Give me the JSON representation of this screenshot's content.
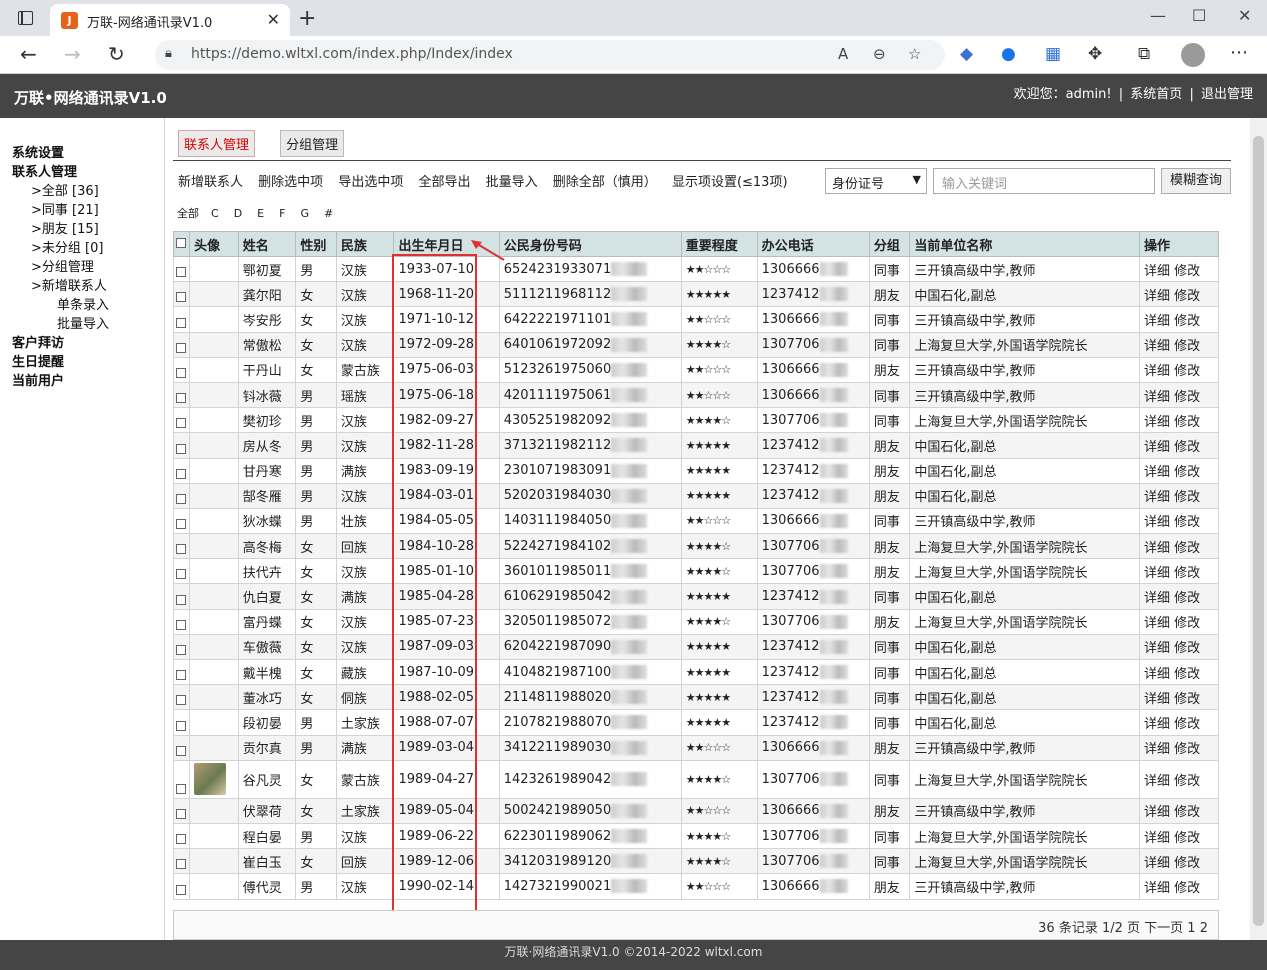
{
  "browser": {
    "tab_title": "万联-网络通讯录V1.0",
    "url": "https://demo.wltxl.com/index.php/Index/index"
  },
  "header": {
    "brand": "万联•网络通讯录V1.0",
    "welcome": "欢迎您：admin!",
    "sep": "|",
    "home": "系统首页",
    "logout": "退出管理"
  },
  "sidebar": {
    "system": "系统设置",
    "contacts": "联系人管理",
    "all": ">全部 [36]",
    "colleague": ">同事 [21]",
    "friend": ">朋友 [15]",
    "ungrouped": ">未分组 [0]",
    "groups": ">分组管理",
    "add": ">新增联系人",
    "single": "单条录入",
    "batch": "批量导入",
    "visits": "客户拜访",
    "birthday": "生日提醒",
    "user": "当前用户"
  },
  "tabs": {
    "contacts": "联系人管理",
    "groups": "分组管理"
  },
  "toolbar": {
    "add": "新增联系人",
    "delsel": "删除选中项",
    "expsel": "导出选中项",
    "expall": "全部导出",
    "import": "批量导入",
    "delall": "删除全部（慎用）",
    "cols": "显示项设置(≤13项)"
  },
  "search": {
    "field": "身份证号",
    "placeholder": "输入关键词",
    "button": "模糊查询"
  },
  "letters": [
    "全部",
    "C",
    "D",
    "E",
    "F",
    "G",
    "#"
  ],
  "columns": [
    "头像",
    "姓名",
    "性别",
    "民族",
    "出生年月日",
    "公民身份号码",
    "重要程度",
    "办公电话",
    "分组",
    "当前单位名称",
    "操作"
  ],
  "rows": [
    [
      "鄂初夏",
      "男",
      "汉族",
      "1933-07-10",
      "6524231933071",
      "★★☆☆☆",
      "1306666",
      "同事",
      "三开镇高级中学,教师"
    ],
    [
      "龚尔阳",
      "女",
      "汉族",
      "1968-11-20",
      "5111211968112",
      "★★★★★",
      "1237412",
      "朋友",
      "中国石化,副总"
    ],
    [
      "岑安彤",
      "女",
      "汉族",
      "1971-10-12",
      "6422221971101",
      "★★☆☆☆",
      "1306666",
      "同事",
      "三开镇高级中学,教师"
    ],
    [
      "常傲松",
      "女",
      "汉族",
      "1972-09-28",
      "6401061972092",
      "★★★★☆",
      "1307706",
      "同事",
      "上海复旦大学,外国语学院院长"
    ],
    [
      "干丹山",
      "女",
      "蒙古族",
      "1975-06-03",
      "5123261975060",
      "★★☆☆☆",
      "1306666",
      "朋友",
      "三开镇高级中学,教师"
    ],
    [
      "钭冰薇",
      "男",
      "瑶族",
      "1975-06-18",
      "4201111975061",
      "★★☆☆☆",
      "1306666",
      "同事",
      "三开镇高级中学,教师"
    ],
    [
      "樊初珍",
      "男",
      "汉族",
      "1982-09-27",
      "4305251982092",
      "★★★★☆",
      "1307706",
      "同事",
      "上海复旦大学,外国语学院院长"
    ],
    [
      "房从冬",
      "男",
      "汉族",
      "1982-11-28",
      "3713211982112",
      "★★★★★",
      "1237412",
      "朋友",
      "中国石化,副总"
    ],
    [
      "甘丹寒",
      "男",
      "满族",
      "1983-09-19",
      "2301071983091",
      "★★★★★",
      "1237412",
      "朋友",
      "中国石化,副总"
    ],
    [
      "郜冬雁",
      "男",
      "汉族",
      "1984-03-01",
      "5202031984030",
      "★★★★★",
      "1237412",
      "朋友",
      "中国石化,副总"
    ],
    [
      "狄冰蝶",
      "男",
      "壮族",
      "1984-05-05",
      "1403111984050",
      "★★☆☆☆",
      "1306666",
      "同事",
      "三开镇高级中学,教师"
    ],
    [
      "高冬梅",
      "女",
      "回族",
      "1984-10-28",
      "5224271984102",
      "★★★★☆",
      "1307706",
      "朋友",
      "上海复旦大学,外国语学院院长"
    ],
    [
      "扶代卉",
      "女",
      "汉族",
      "1985-01-10",
      "3601011985011",
      "★★★★☆",
      "1307706",
      "朋友",
      "上海复旦大学,外国语学院院长"
    ],
    [
      "仇白夏",
      "女",
      "满族",
      "1985-04-28",
      "6106291985042",
      "★★★★★",
      "1237412",
      "同事",
      "中国石化,副总"
    ],
    [
      "富丹蝶",
      "女",
      "汉族",
      "1985-07-23",
      "3205011985072",
      "★★★★☆",
      "1307706",
      "朋友",
      "上海复旦大学,外国语学院院长"
    ],
    [
      "车傲薇",
      "女",
      "汉族",
      "1987-09-03",
      "6204221987090",
      "★★★★★",
      "1237412",
      "同事",
      "中国石化,副总"
    ],
    [
      "戴半槐",
      "女",
      "藏族",
      "1987-10-09",
      "4104821987100",
      "★★★★★",
      "1237412",
      "同事",
      "中国石化,副总"
    ],
    [
      "董冰巧",
      "女",
      "侗族",
      "1988-02-05",
      "2114811988020",
      "★★★★★",
      "1237412",
      "同事",
      "中国石化,副总"
    ],
    [
      "段初晏",
      "男",
      "土家族",
      "1988-07-07",
      "2107821988070",
      "★★★★★",
      "1237412",
      "同事",
      "中国石化,副总"
    ],
    [
      "贡尔真",
      "男",
      "满族",
      "1989-03-04",
      "3412211989030",
      "★★☆☆☆",
      "1306666",
      "朋友",
      "三开镇高级中学,教师"
    ],
    [
      "谷凡灵",
      "女",
      "蒙古族",
      "1989-04-27",
      "1423261989042",
      "★★★★☆",
      "1307706",
      "同事",
      "上海复旦大学,外国语学院院长"
    ],
    [
      "伏翠荷",
      "女",
      "土家族",
      "1989-05-04",
      "5002421989050",
      "★★☆☆☆",
      "1306666",
      "朋友",
      "三开镇高级中学,教师"
    ],
    [
      "程白晏",
      "男",
      "汉族",
      "1989-06-22",
      "6223011989062",
      "★★★★☆",
      "1307706",
      "同事",
      "上海复旦大学,外国语学院院长"
    ],
    [
      "崔白玉",
      "女",
      "回族",
      "1989-12-06",
      "3412031989120",
      "★★★★☆",
      "1307706",
      "同事",
      "上海复旦大学,外国语学院院长"
    ],
    [
      "傅代灵",
      "男",
      "汉族",
      "1990-02-14",
      "1427321990021",
      "★★☆☆☆",
      "1306666",
      "朋友",
      "三开镇高级中学,教师"
    ]
  ],
  "row_actions": {
    "detail": "详细",
    "edit": "修改"
  },
  "pager": {
    "summary": "36 条记录 1/2 页 下一页",
    "p1": "1",
    "p2": "2"
  },
  "footer": "万联·网络通讯录V1.0 ©2014-2022 wltxl.com"
}
